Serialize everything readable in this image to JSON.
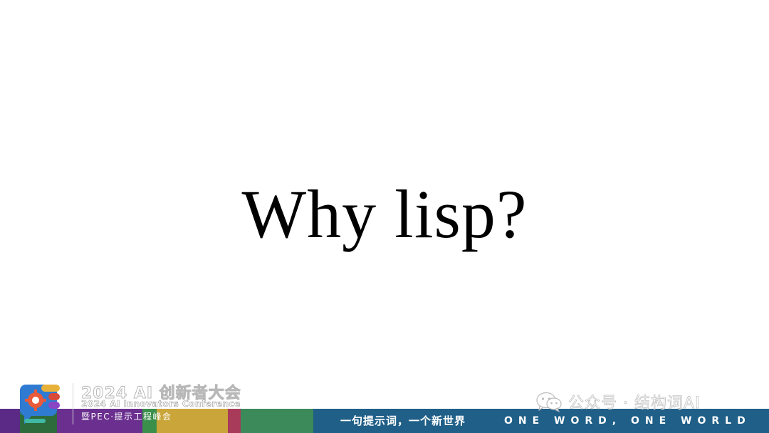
{
  "slide": {
    "title": "Why lisp?"
  },
  "footer": {
    "slogan_cn": "一句提示词，一个新世界",
    "slogan_en": "ONE WORD, ONE WORLD",
    "colors": {
      "bar_segments": [
        "#5b2a86",
        "#2e6b3c",
        "#6a2f8f",
        "#3a8f4a",
        "#c9a53a",
        "#a83a5a",
        "#3c8a5a"
      ],
      "teal": "#1f5f88"
    }
  },
  "conference": {
    "title": "2024 AI 创新者大会",
    "subtitle": "2024 AI Innovators Conference",
    "tagline": "暨PEC·提示工程峰会",
    "logo_icon": "gear-chat-logo-icon"
  },
  "watermark": {
    "icon": "wechat-icon",
    "text": "公众号 · 结构词AI"
  }
}
